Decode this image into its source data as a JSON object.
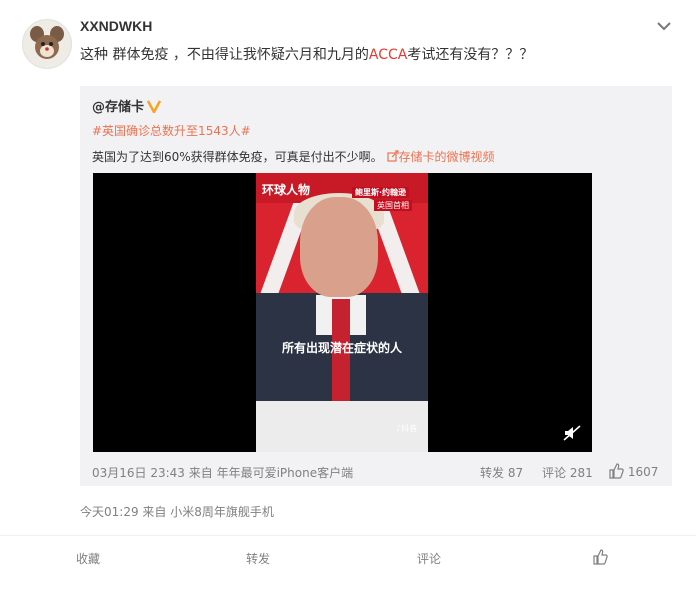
{
  "post": {
    "username": "XXNDWKH",
    "text_before": "这种 群体免疫 ，不由得让我怀疑六月和九月的",
    "text_highlight": "ACCA",
    "text_after": "考试还有没有？？？",
    "time_line": "今天01:29  来自 小米8周年旗舰手机"
  },
  "repost": {
    "username": "@存储卡",
    "hashtag": "#英国确诊总数升至1543人#",
    "text": "英国为了达到60%获得群体免疫，可真是付出不少啊。",
    "video_link_icon": "link-icon",
    "video_link": "存储卡的微博视频",
    "video": {
      "brand_left": "环球人物",
      "brand_right_1": "鲍里斯·约翰逊",
      "brand_right_2": "英国首相",
      "caption": "所有出现潜在症状的人",
      "watermark": "抖音"
    },
    "meta": "03月16日 23:43 来自 年年最可爱iPhone客户端",
    "repost_count": "转发 87",
    "comment_count": "评论 281",
    "like_count": "1607"
  },
  "actions": {
    "favorite": "收藏",
    "repost": "转发",
    "comment": "评论"
  },
  "colors": {
    "accent": "#eb7350",
    "highlight": "#e53935",
    "repost_bg": "#f2f2f5"
  }
}
